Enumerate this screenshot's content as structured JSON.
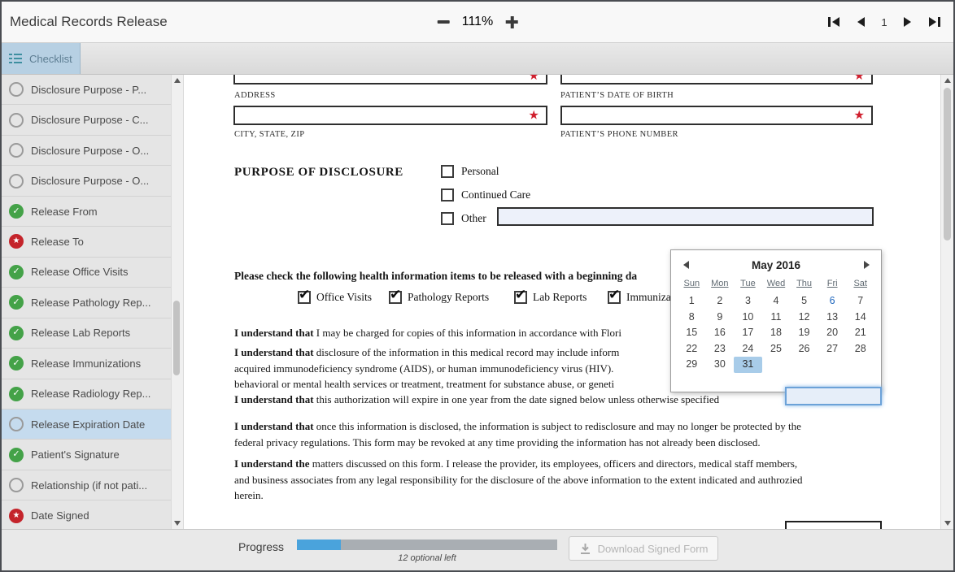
{
  "window": {
    "title": "Medical Records Release"
  },
  "header": {
    "zoom_level": "111%",
    "page_number": "1"
  },
  "toolbar": {
    "checklist": "Checklist"
  },
  "sidebar": {
    "items": [
      {
        "label": "Disclosure Purpose - P...",
        "status": "empty",
        "selected": false
      },
      {
        "label": "Disclosure Purpose - C...",
        "status": "empty",
        "selected": false
      },
      {
        "label": "Disclosure Purpose - O...",
        "status": "empty",
        "selected": false
      },
      {
        "label": "Disclosure Purpose - O...",
        "status": "empty",
        "selected": false
      },
      {
        "label": "Release From",
        "status": "done",
        "selected": false
      },
      {
        "label": "Release To",
        "status": "required",
        "selected": false
      },
      {
        "label": "Release Office Visits",
        "status": "done",
        "selected": false
      },
      {
        "label": "Release Pathology Rep...",
        "status": "done",
        "selected": false
      },
      {
        "label": "Release Lab Reports",
        "status": "done",
        "selected": false
      },
      {
        "label": "Release Immunizations",
        "status": "done",
        "selected": false
      },
      {
        "label": "Release Radiology Rep...",
        "status": "done",
        "selected": false
      },
      {
        "label": "Release Expiration Date",
        "status": "empty",
        "selected": true
      },
      {
        "label": "Patient's Signature",
        "status": "done",
        "selected": false
      },
      {
        "label": "Relationship (if not pati...",
        "status": "empty",
        "selected": false
      },
      {
        "label": "Date Signed",
        "status": "required",
        "selected": false
      }
    ]
  },
  "doc": {
    "labels": {
      "address": "ADDRESS",
      "dob": "PATIENT’S DATE OF BIRTH",
      "city": "CITY, STATE, ZIP",
      "phone": "PATIENT’S PHONE NUMBER"
    },
    "purpose": {
      "heading": "PURPOSE OF DISCLOSURE",
      "options": [
        {
          "label": "Personal",
          "checked": false
        },
        {
          "label": "Continued Care",
          "checked": false
        },
        {
          "label": "Other",
          "checked": false
        }
      ]
    },
    "release_prompt": "Please check the following health information items to be released with a beginning da",
    "release_items": [
      {
        "label": "Office Visits",
        "checked": true
      },
      {
        "label": "Pathology Reports",
        "checked": true
      },
      {
        "label": "Lab Reports",
        "checked": true
      },
      {
        "label": "Immunizations",
        "checked": true
      }
    ],
    "paragraphs": [
      {
        "lines": [
          {
            "bold": "I understand that",
            "rest": " I may be charged for copies of this information in accordance with Flori"
          }
        ]
      },
      {
        "lines": [
          {
            "bold": "I understand that",
            "rest": " disclosure of the information in this medical record may include inform"
          },
          {
            "bold": "",
            "rest": "acquired immunodeficiency syndrome (AIDS), or human immunodeficiency virus (HIV)."
          },
          {
            "bold": "",
            "rest": "behavioral or mental health services or treatment, treatment for substance abuse, or geneti"
          }
        ]
      },
      {
        "lines": [
          {
            "bold": "I understand that",
            "rest": " this authorization will expire in one year from the date signed below unless otherwise specified"
          }
        ]
      },
      {
        "lines": [
          {
            "bold": "I understand that",
            "rest": " once this information is disclosed, the information is subject to redisclosure and may no longer be protected by the"
          },
          {
            "bold": "",
            "rest": "federal privacy regulations. This form may be revoked at any time providing the information has not already been disclosed."
          }
        ]
      },
      {
        "lines": [
          {
            "bold": "I understand the",
            "rest": " matters discussed on this form. I release the provider, its employees, officers and directors, medical staff members,"
          },
          {
            "bold": "",
            "rest": "and business associates from any legal responsibility for the disclosure of the above information to the extent indicated and authrozied"
          },
          {
            "bold": "",
            "rest": "herein."
          }
        ]
      }
    ]
  },
  "calendar": {
    "month_title": "May 2016",
    "weekdays": [
      "Sun",
      "Mon",
      "Tue",
      "Wed",
      "Thu",
      "Fri",
      "Sat"
    ],
    "weeks": [
      [
        1,
        2,
        3,
        4,
        5,
        6,
        7
      ],
      [
        8,
        9,
        10,
        11,
        12,
        13,
        14
      ],
      [
        15,
        16,
        17,
        18,
        19,
        20,
        21
      ],
      [
        22,
        23,
        24,
        25,
        26,
        27,
        28
      ],
      [
        29,
        30,
        31,
        null,
        null,
        null,
        null
      ]
    ],
    "today": 6,
    "selected": 31
  },
  "footer": {
    "progress_label": "Progress",
    "progress_fraction": 0.17,
    "optional_left": "12 optional left",
    "download_label": "Download Signed Form"
  },
  "colors": {
    "accent_blue": "#4aa3dc",
    "complete_green": "#44a248",
    "required_red": "#c4242b",
    "selected_item_blue": "#c5dbee",
    "calendar_selected_blue": "#a8cce9"
  }
}
